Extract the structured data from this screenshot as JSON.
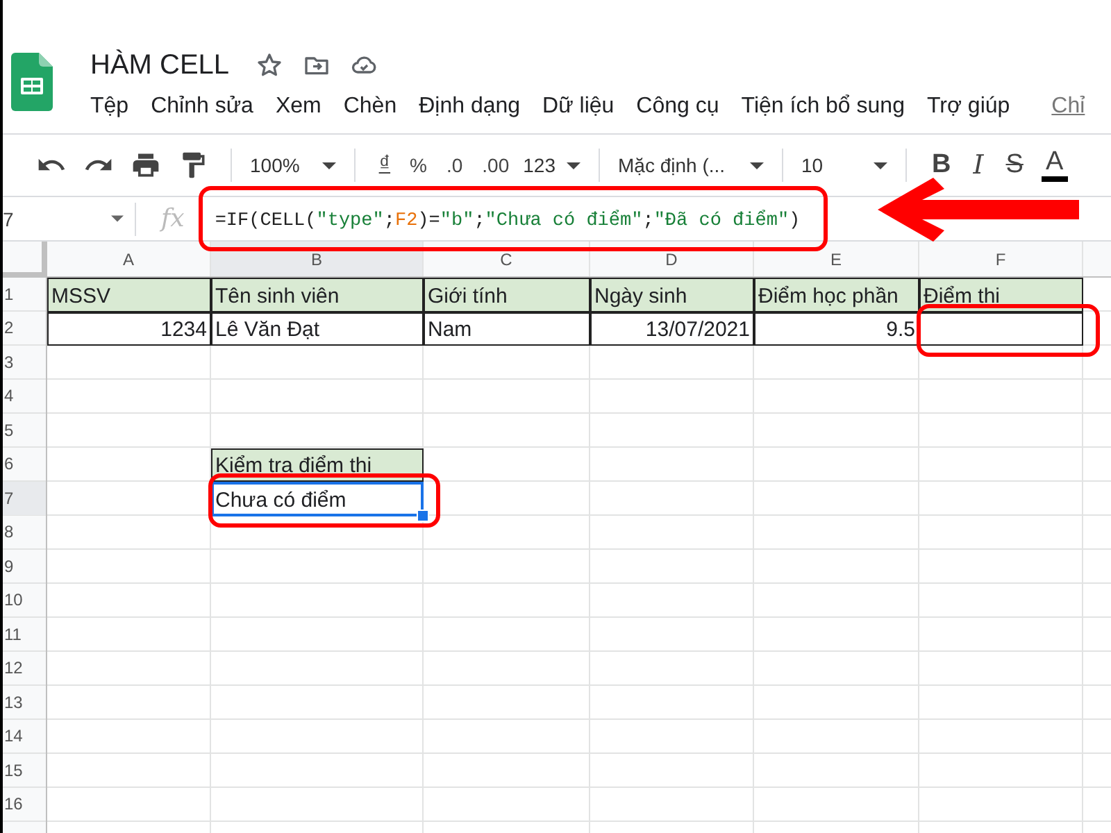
{
  "document": {
    "title": "HÀM CELL"
  },
  "menu": [
    {
      "label": "Tệp",
      "kind": "menu"
    },
    {
      "label": "Chỉnh sửa",
      "kind": "menu"
    },
    {
      "label": "Xem",
      "kind": "menu"
    },
    {
      "label": "Chèn",
      "kind": "menu"
    },
    {
      "label": "Định dạng",
      "kind": "menu"
    },
    {
      "label": "Dữ liệu",
      "kind": "menu"
    },
    {
      "label": "Công cụ",
      "kind": "menu"
    },
    {
      "label": "Tiện ích bổ sung",
      "kind": "menu"
    },
    {
      "label": "Trợ giúp",
      "kind": "menu"
    },
    {
      "label": "Chỉ",
      "kind": "link"
    }
  ],
  "toolbar": {
    "zoom": "100%",
    "currency": "₫",
    "percent": "%",
    "decrease_decimals": ".0",
    "increase_decimals": ".00",
    "number_format": "123",
    "font": "Mặc định (...",
    "font_size": "10",
    "bold": "B",
    "italic": "I",
    "strikethrough": "S",
    "text_color": "A"
  },
  "formula_bar": {
    "name_box": "7",
    "function_label": "fx",
    "circled": true,
    "formula": [
      {
        "text": "=IF(CELL(",
        "kind": "plain"
      },
      {
        "text": "\"type\"",
        "kind": "string"
      },
      {
        "text": ";",
        "kind": "plain"
      },
      {
        "text": "F2",
        "kind": "ref"
      },
      {
        "text": ")=",
        "kind": "plain"
      },
      {
        "text": "\"b\"",
        "kind": "string"
      },
      {
        "text": ";",
        "kind": "plain"
      },
      {
        "text": "\"Chưa có điểm\"",
        "kind": "string"
      },
      {
        "text": ";",
        "kind": "plain"
      },
      {
        "text": "\"Đã có điểm\"",
        "kind": "string"
      },
      {
        "text": ")",
        "kind": "plain"
      }
    ]
  },
  "arrow": true,
  "columns": [
    "A",
    "B",
    "C",
    "D",
    "E",
    "F"
  ],
  "rows": [
    {
      "number": "1",
      "cells": [
        {
          "text": "MSSV",
          "numeric": false,
          "highlighted": true,
          "bordered": true,
          "selected": false,
          "circled": false
        },
        {
          "text": "Tên sinh viên",
          "numeric": false,
          "highlighted": true,
          "bordered": true,
          "selected": false,
          "circled": false
        },
        {
          "text": "Giới tính",
          "numeric": false,
          "highlighted": true,
          "bordered": true,
          "selected": false,
          "circled": false
        },
        {
          "text": "Ngày sinh",
          "numeric": false,
          "highlighted": true,
          "bordered": true,
          "selected": false,
          "circled": false
        },
        {
          "text": "Điểm học phần",
          "numeric": false,
          "highlighted": true,
          "bordered": true,
          "selected": false,
          "circled": false
        },
        {
          "text": "Điểm thi",
          "numeric": false,
          "highlighted": true,
          "bordered": true,
          "selected": false,
          "circled": false
        }
      ]
    },
    {
      "number": "2",
      "cells": [
        {
          "text": "1234",
          "numeric": true,
          "highlighted": false,
          "bordered": true,
          "selected": false,
          "circled": false
        },
        {
          "text": "Lê Văn Đạt",
          "numeric": false,
          "highlighted": false,
          "bordered": true,
          "selected": false,
          "circled": false
        },
        {
          "text": "Nam",
          "numeric": false,
          "highlighted": false,
          "bordered": true,
          "selected": false,
          "circled": false
        },
        {
          "text": "13/07/2021",
          "numeric": true,
          "highlighted": false,
          "bordered": true,
          "selected": false,
          "circled": false
        },
        {
          "text": "9.5",
          "numeric": true,
          "highlighted": false,
          "bordered": true,
          "selected": false,
          "circled": false
        },
        {
          "highlighted": false,
          "bordered": true,
          "selected": false,
          "circled": true
        }
      ]
    },
    {
      "number": "3"
    },
    {
      "number": "4"
    },
    {
      "number": "5"
    },
    {
      "number": "6",
      "cells": [
        null,
        {
          "text": "Kiểm tra điểm thi",
          "numeric": false,
          "highlighted": true,
          "bordered": true,
          "selected": false,
          "circled": false
        }
      ]
    },
    {
      "number": "7",
      "cells": [
        null,
        {
          "text": "Chưa có điểm",
          "numeric": false,
          "highlighted": false,
          "selected": true,
          "circled": true
        }
      ]
    },
    {
      "number": "8"
    },
    {
      "number": "9"
    },
    {
      "number": "10"
    },
    {
      "number": "11"
    },
    {
      "number": "12"
    },
    {
      "number": "13"
    },
    {
      "number": "14"
    },
    {
      "number": "15"
    },
    {
      "number": "16"
    }
  ]
}
